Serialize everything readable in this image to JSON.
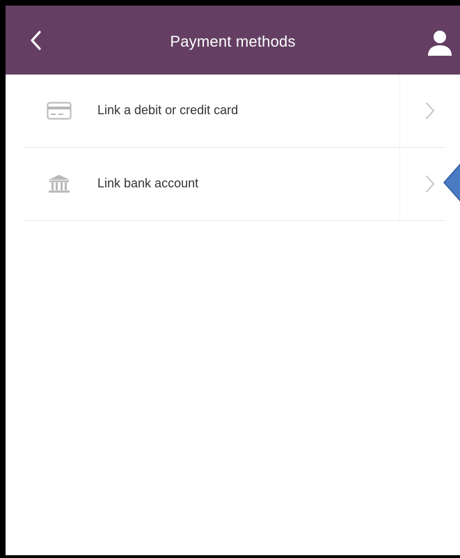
{
  "colors": {
    "header_bg": "#643f63",
    "header_text": "#ffffff",
    "row_text": "#333333",
    "icon_gray": "#b7b7b7",
    "chevron_gray": "#c4c4c4",
    "divider": "#e6e6e6",
    "callout_fill": "#4a7bc4"
  },
  "header": {
    "title": "Payment methods",
    "back_icon": "chevron-left-icon",
    "profile_icon": "person-icon"
  },
  "payment_methods": [
    {
      "label": "Link a debit or credit card",
      "icon": "credit-card-icon",
      "chevron": "chevron-right-icon"
    },
    {
      "label": "Link bank account",
      "icon": "bank-icon",
      "chevron": "chevron-right-icon"
    }
  ],
  "annotation": {
    "shape": "blue-diamond-callout",
    "points_to": "Link bank account"
  }
}
